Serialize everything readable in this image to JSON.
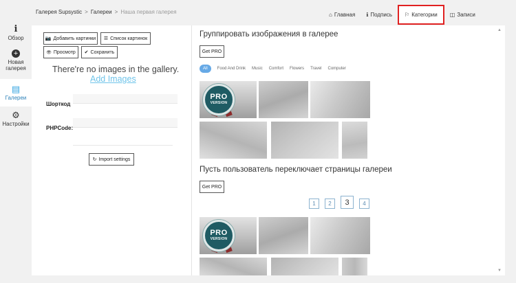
{
  "sidebar": {
    "items": [
      {
        "icon": "info-icon",
        "glyph": "i",
        "label": "Обзор"
      },
      {
        "icon": "plus-circle-icon",
        "glyph": "+",
        "label": "Новая галерея"
      },
      {
        "icon": "gallery-icon",
        "glyph": "▤",
        "label": "Галереи"
      },
      {
        "icon": "gear-icon",
        "glyph": "⚙",
        "label": "Настройки"
      }
    ]
  },
  "breadcrumb": {
    "root": "Галерея Supsystic",
    "section": "Галереи",
    "current": "Наша первая галерея",
    "separator": ">"
  },
  "tabs": [
    {
      "icon": "home-icon",
      "glyph": "⌂",
      "label": "Главная"
    },
    {
      "icon": "info-icon",
      "glyph": "ℹ",
      "label": "Подпись"
    },
    {
      "icon": "bookmark-icon",
      "glyph": "⚐",
      "label": "Категории",
      "highlighted": true
    },
    {
      "icon": "columns-icon",
      "glyph": "◫",
      "label": "Записи"
    }
  ],
  "left_panel": {
    "buttons": {
      "add_images": {
        "glyph": "📷",
        "label": "Добавить картинки"
      },
      "image_list": {
        "glyph": "☰",
        "label": "Список картинок"
      },
      "preview": {
        "glyph": "👁",
        "label": "Просмотр"
      },
      "save": {
        "glyph": "✔",
        "label": "Сохранить"
      }
    },
    "empty_text": "There're no images in the gallery.",
    "add_images_link": "Add Images",
    "shortcode_label": "Шорткод",
    "php_code_label": "PHPCode:",
    "import_button": {
      "glyph": "↻",
      "label": "Import settings"
    }
  },
  "right_panel": {
    "group_title": "Группировать изображения в галерее",
    "get_pro_label": "Get PRO",
    "categories": [
      "All",
      "Food And Drink",
      "Music",
      "Comfort",
      "Flowers",
      "Travel",
      "Computer"
    ],
    "pagination_title": "Пусть пользователь переключает страницы галереи",
    "pages": [
      "1",
      "2",
      "3",
      "4"
    ],
    "current_page": "3",
    "badge_top": "PRO",
    "badge_bottom": "VERSION"
  },
  "colors": {
    "accent": "#35a4e0",
    "link": "#6fc4ea",
    "highlight_border": "#e02020",
    "badge": "#1f5b63"
  }
}
